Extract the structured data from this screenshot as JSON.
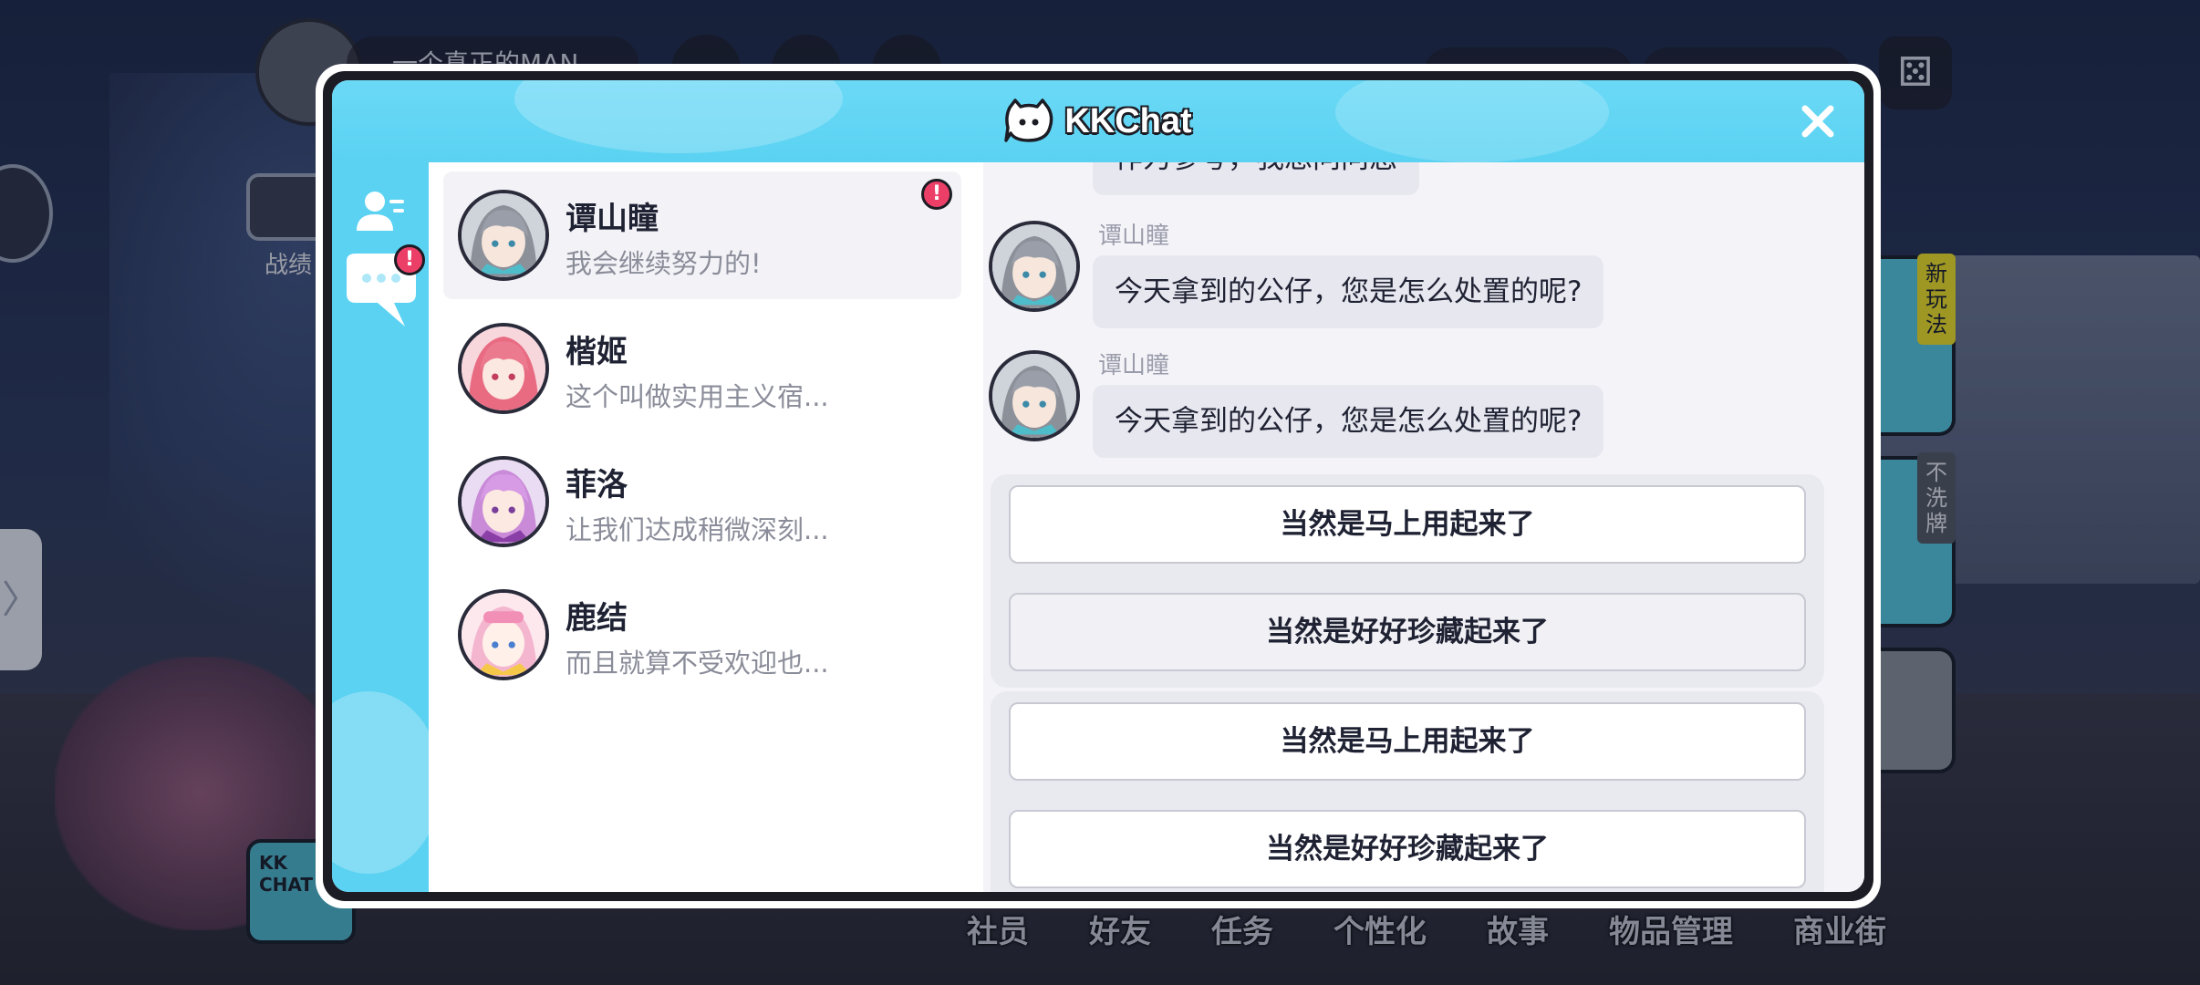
{
  "background": {
    "player_name": "一个真正的MAN",
    "battle_label": "战绩",
    "side_tags": [
      "新玩法",
      "不洗牌"
    ],
    "kk_logo_text": "KK CHAT",
    "bottom_nav": [
      "社员",
      "好友",
      "任务",
      "个性化",
      "故事",
      "物品管理",
      "商业街"
    ],
    "left_tab_glyph": "〉"
  },
  "modal": {
    "title": "KKChat",
    "close_glyph": "✕",
    "accent_color": "#5bd2f2",
    "alert_color": "#ec3f68"
  },
  "rail": {
    "contacts_icon": "contacts-icon",
    "chats_icon": "chat-bubble-icon",
    "chats_alert": "!"
  },
  "contacts": [
    {
      "name": "谭山瞳",
      "preview": "我会继续努力的!",
      "selected": true,
      "alert": "!"
    },
    {
      "name": "楷姬",
      "preview": "这个叫做实用主义宿...",
      "selected": false
    },
    {
      "name": "菲洛",
      "preview": "让我们达成稍微深刻...",
      "selected": false
    },
    {
      "name": "鹿结",
      "preview": "而且就算不受欢迎也...",
      "selected": false
    }
  ],
  "chat": {
    "partial_message": "作为参考，我想问问您",
    "messages": [
      {
        "sender": "谭山瞳",
        "text": "今天拿到的公仔，您是怎么处置的呢?"
      },
      {
        "sender": "谭山瞳",
        "text": "今天拿到的公仔，您是怎么处置的呢?"
      }
    ],
    "option_groups": [
      {
        "options": [
          "当然是马上用起来了",
          "当然是好好珍藏起来了"
        ]
      },
      {
        "options": [
          "当然是马上用起来了",
          "当然是好好珍藏起来了"
        ]
      }
    ]
  }
}
